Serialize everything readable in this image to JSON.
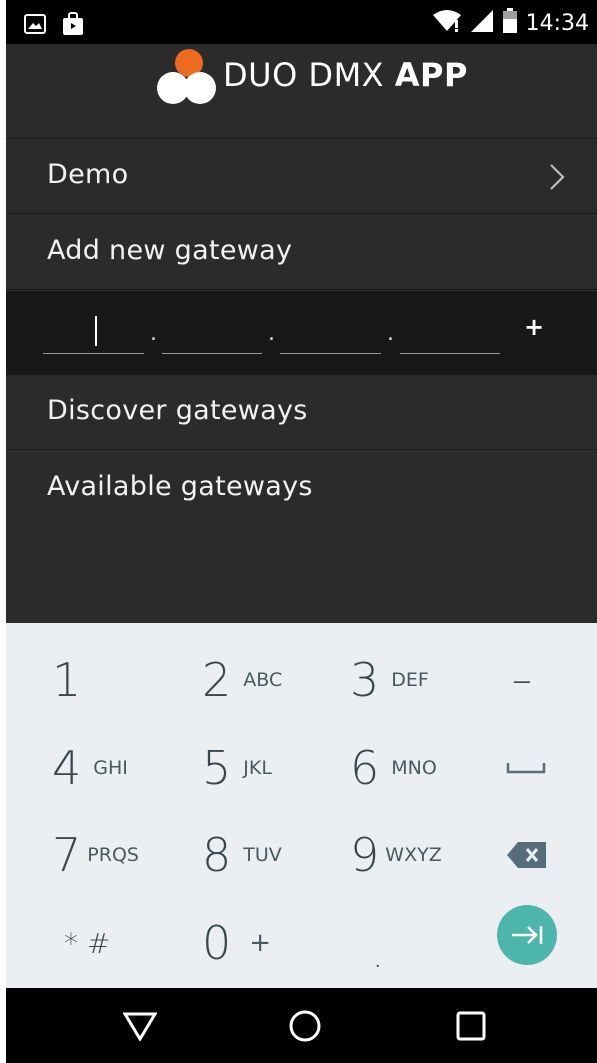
{
  "status_bar": {
    "time": "14:34",
    "icons": [
      "image-notification-icon",
      "shopping-bag-icon",
      "wifi-icon",
      "signal-icon",
      "battery-icon"
    ]
  },
  "app": {
    "title_light": "DUO DMX ",
    "title_bold": "APP",
    "logo": "duo-dmx-logo",
    "logo_colors": {
      "orange": "#ee6a1f",
      "white": "#ffffff"
    }
  },
  "list": {
    "demo_label": "Demo",
    "add_gateway_label": "Add new gateway",
    "discover_label": "Discover gateways",
    "available_label": "Available gateways"
  },
  "ip_input": {
    "octet_values": [
      "",
      "",
      "",
      ""
    ],
    "separator": ".",
    "add_label": "+"
  },
  "keyboard": {
    "keys": [
      {
        "main": "1",
        "sub": ""
      },
      {
        "main": "2",
        "sub": "ABC"
      },
      {
        "main": "3",
        "sub": "DEF"
      },
      {
        "main": "–",
        "sub": ""
      },
      {
        "main": "4",
        "sub": "GHI"
      },
      {
        "main": "5",
        "sub": "JKL"
      },
      {
        "main": "6",
        "sub": "MNO"
      },
      {
        "main": "space",
        "sub": ""
      },
      {
        "main": "7",
        "sub": "PRQS"
      },
      {
        "main": "8",
        "sub": "TUV"
      },
      {
        "main": "9",
        "sub": "WXYZ"
      },
      {
        "main": "backspace",
        "sub": ""
      },
      {
        "main": "* #",
        "sub": ""
      },
      {
        "main": "0",
        "sub": "+"
      },
      {
        "main": ".",
        "sub": ""
      },
      {
        "main": "next",
        "sub": ""
      }
    ],
    "accent": "#4db6ac"
  },
  "nav_bar": {
    "buttons": [
      "back-icon",
      "home-icon",
      "recents-icon"
    ]
  }
}
